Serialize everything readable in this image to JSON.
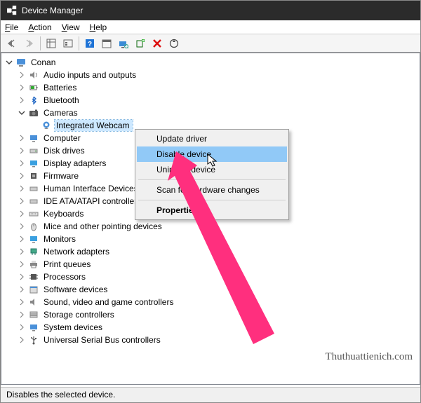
{
  "window": {
    "title": "Device Manager"
  },
  "menu": {
    "file": "File",
    "action": "Action",
    "view": "View",
    "help": "Help"
  },
  "root": "Conan",
  "tree": {
    "audio": "Audio inputs and outputs",
    "batteries": "Batteries",
    "bluetooth": "Bluetooth",
    "cameras": "Cameras",
    "webcam": "Integrated Webcam",
    "computer": "Computer",
    "disk": "Disk drives",
    "display": "Display adapters",
    "firmware": "Firmware",
    "hid": "Human Interface Devices",
    "ide": "IDE ATA/ATAPI controllers",
    "keyboards": "Keyboards",
    "mice": "Mice and other pointing devices",
    "monitors": "Monitors",
    "network": "Network adapters",
    "print": "Print queues",
    "processors": "Processors",
    "software": "Software devices",
    "sound": "Sound, video and game controllers",
    "storage": "Storage controllers",
    "system": "System devices",
    "usb": "Universal Serial Bus controllers"
  },
  "context": {
    "update": "Update driver",
    "disable": "Disable device",
    "uninstall": "Uninstall device",
    "scan": "Scan for hardware changes",
    "properties": "Properties"
  },
  "status": "Disables the selected device.",
  "watermark": "Thuthuattienich.com"
}
